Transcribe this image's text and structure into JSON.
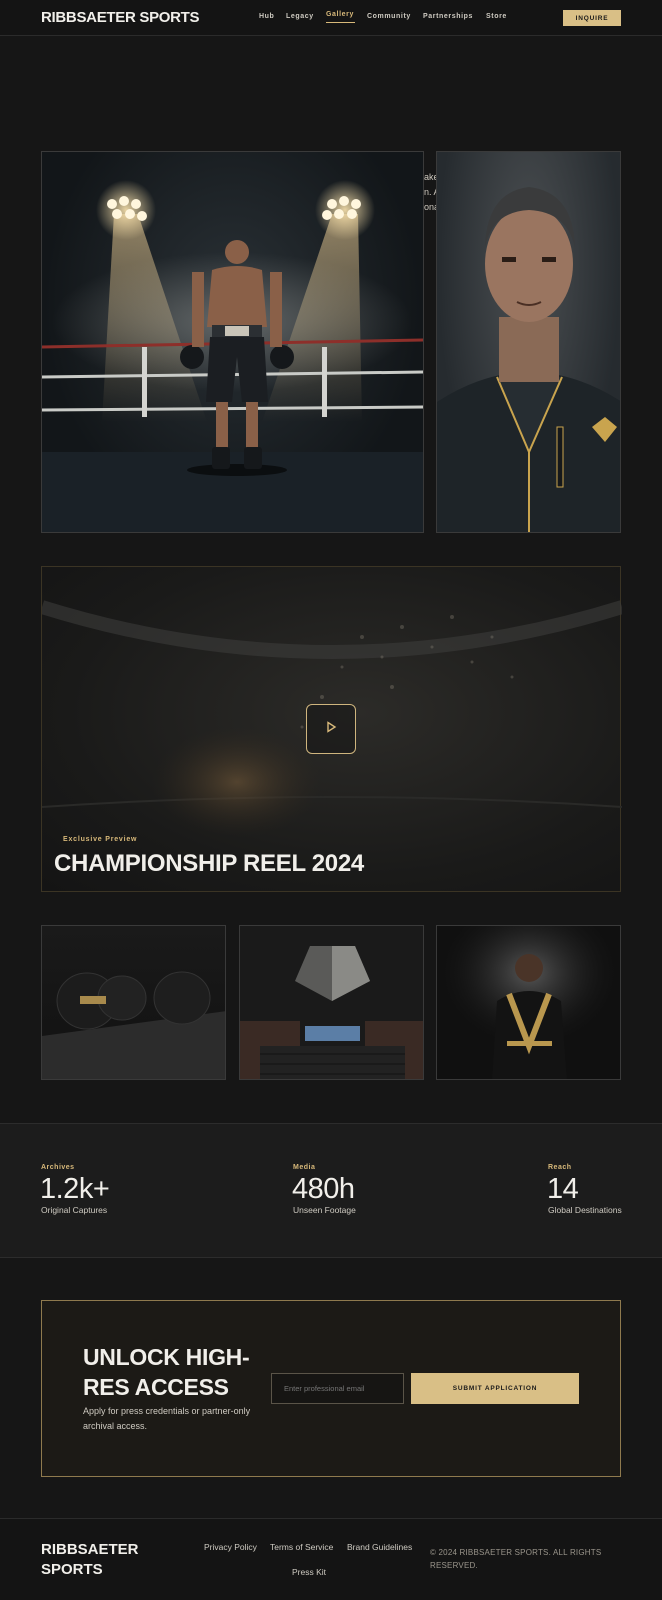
{
  "header": {
    "logo": "RIBBSAETER SPORTS",
    "nav": [
      "Hub",
      "Legacy",
      "Gallery",
      "Community",
      "Partnerships",
      "Store"
    ],
    "active_nav": "Gallery",
    "inquire_label": "INQUIRE"
  },
  "hero": {
    "peek_lines": [
      "ake",
      "n. A",
      "ona"
    ]
  },
  "video": {
    "eyebrow": "Exclusive Preview",
    "title": "CHAMPIONSHIP REEL 2024"
  },
  "stats": [
    {
      "label": "Archives",
      "value": "1.2k+",
      "desc": "Original Captures"
    },
    {
      "label": "Media",
      "value": "480h",
      "desc": "Unseen Footage"
    },
    {
      "label": "Reach",
      "value": "14",
      "desc": "Global Destinations"
    }
  ],
  "cta": {
    "title": "UNLOCK HIGH-RES ACCESS",
    "subtitle": "Apply for press credentials or partner-only archival access.",
    "email_placeholder": "Enter professional email",
    "submit_label": "SUBMIT APPLICATION"
  },
  "footer": {
    "logo": "RIBBSAETER SPORTS",
    "links": [
      "Privacy Policy",
      "Terms of Service",
      "Brand Guidelines",
      "Press Kit"
    ],
    "copyright": "© 2024 RIBBSAETER SPORTS. ALL RIGHTS RESERVED."
  },
  "colors": {
    "accent": "#d9bf86",
    "background": "#161616"
  }
}
